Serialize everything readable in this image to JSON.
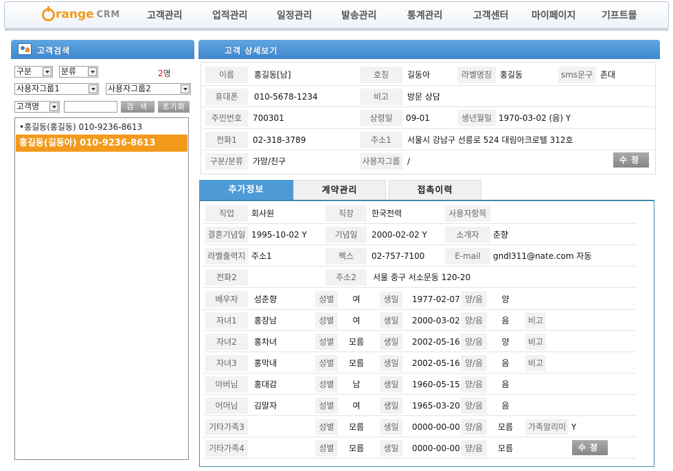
{
  "nav": {
    "logo_main": "range",
    "logo_crm": "CRM",
    "menu": [
      "고객관리",
      "업적관리",
      "일정관리",
      "발송관리",
      "통계관리",
      "고객센터",
      "마이페이지",
      "기프트몰"
    ]
  },
  "left": {
    "header": "고객검색",
    "sel_gubun": "구분",
    "sel_bunryu": "분류",
    "count": "2",
    "count_unit": "명",
    "sel_group1": "사용자그룹1",
    "sel_group2": "사용자그룹2",
    "sel_name": "고객명",
    "search_input": "",
    "search_btn": "검 색",
    "reset_btn": "초기화",
    "items": [
      "•홍길동(홍길동) 010-9236-8613",
      "홍길동(길동아) 010-9236-8613"
    ]
  },
  "detail": {
    "header": "고객 상세보기",
    "l_name": "이름",
    "v_name": "홍길동[남]",
    "l_title": "호칭",
    "v_title": "길동아",
    "l_label": "라벨명칭",
    "v_label": "홍길동",
    "l_sms": "sms문구",
    "v_sms": "존대",
    "l_mobile": "휴대폰",
    "v_mobile": "010-5678-1234",
    "l_note": "비고",
    "v_note": "방문 상담",
    "l_jumin": "주민번호",
    "v_jumin": "700301",
    "l_anniv": "상령일",
    "v_anniv": "09-01",
    "l_birth": "생년월일",
    "v_birth": "1970-03-02 (음) Y",
    "l_phone1": "전화1",
    "v_phone1": "02-318-3789",
    "l_addr1": "주소1",
    "v_addr1": "서울시 강남구 선릉로 524 대림아크로텔 312호",
    "l_class": "구분/분류",
    "v_class": "가망/친구",
    "l_ugroup": "사용자그룹",
    "v_ugroup": "/",
    "edit_btn": "수정"
  },
  "tabs": [
    "추가정보",
    "계약관리",
    "접촉이력"
  ],
  "extra": {
    "l_job": "직업",
    "v_job": "회사원",
    "l_work": "직장",
    "v_work": "한국전력",
    "l_user": "사용자항목",
    "v_user": "",
    "l_wed": "결혼기념일",
    "v_wed": "1995-10-02 Y",
    "l_memo": "기념일",
    "v_memo": "2000-02-02 Y",
    "l_intro": "소개자",
    "v_intro": "춘향",
    "l_labelout": "라벨출력지",
    "v_labelout": "주소1",
    "l_fax": "펙스",
    "v_fax": "02-757-7100",
    "l_email": "E-mail",
    "v_email": "gndl311@nate.com 자동",
    "l_phone2": "전화2",
    "v_phone2": "",
    "l_addr2": "주소2",
    "v_addr2": "서울 중구 서소문동 120-20",
    "family": [
      {
        "rel": "배우자",
        "name": "성춘향",
        "sex_l": "성별",
        "sex": "여",
        "bd_l": "생일",
        "bd": "1977-02-07",
        "lunar_l": "양/음",
        "lunar": "양",
        "extra_l": "",
        "extra": ""
      },
      {
        "rel": "자녀1",
        "name": "홍장남",
        "sex_l": "성별",
        "sex": "여",
        "bd_l": "생일",
        "bd": "2000-03-02",
        "lunar_l": "양/음",
        "lunar": "음",
        "extra_l": "비고",
        "extra": ""
      },
      {
        "rel": "자녀2",
        "name": "홍차녀",
        "sex_l": "성별",
        "sex": "모름",
        "bd_l": "생일",
        "bd": "2002-05-16",
        "lunar_l": "양/음",
        "lunar": "양",
        "extra_l": "비고",
        "extra": ""
      },
      {
        "rel": "자녀3",
        "name": "홍막내",
        "sex_l": "성별",
        "sex": "모름",
        "bd_l": "생일",
        "bd": "2002-05-16",
        "lunar_l": "양/음",
        "lunar": "음",
        "extra_l": "비고",
        "extra": ""
      },
      {
        "rel": "아버님",
        "name": "홍대감",
        "sex_l": "성별",
        "sex": "남",
        "bd_l": "생일",
        "bd": "1960-05-15",
        "lunar_l": "양/음",
        "lunar": "음",
        "extra_l": "",
        "extra": ""
      },
      {
        "rel": "어머님",
        "name": "김말자",
        "sex_l": "성별",
        "sex": "여",
        "bd_l": "생일",
        "bd": "1965-03-20",
        "lunar_l": "양/음",
        "lunar": "음",
        "extra_l": "",
        "extra": ""
      },
      {
        "rel": "기타가족3",
        "name": "",
        "sex_l": "성별",
        "sex": "모름",
        "bd_l": "생일",
        "bd": "0000-00-00",
        "lunar_l": "양/음",
        "lunar": "모름",
        "extra_l": "가족알리미",
        "extra": "Y"
      },
      {
        "rel": "기타가족4",
        "name": "",
        "sex_l": "성별",
        "sex": "모름",
        "bd_l": "생일",
        "bd": "0000-00-00",
        "lunar_l": "양/음",
        "lunar": "모름",
        "extra_l": "",
        "extra": ""
      }
    ],
    "edit_btn": "수정"
  },
  "colors": {
    "accent": "#f39a1c",
    "header_blue": "#4d9ad6",
    "border_teal": "#3c8aab"
  }
}
